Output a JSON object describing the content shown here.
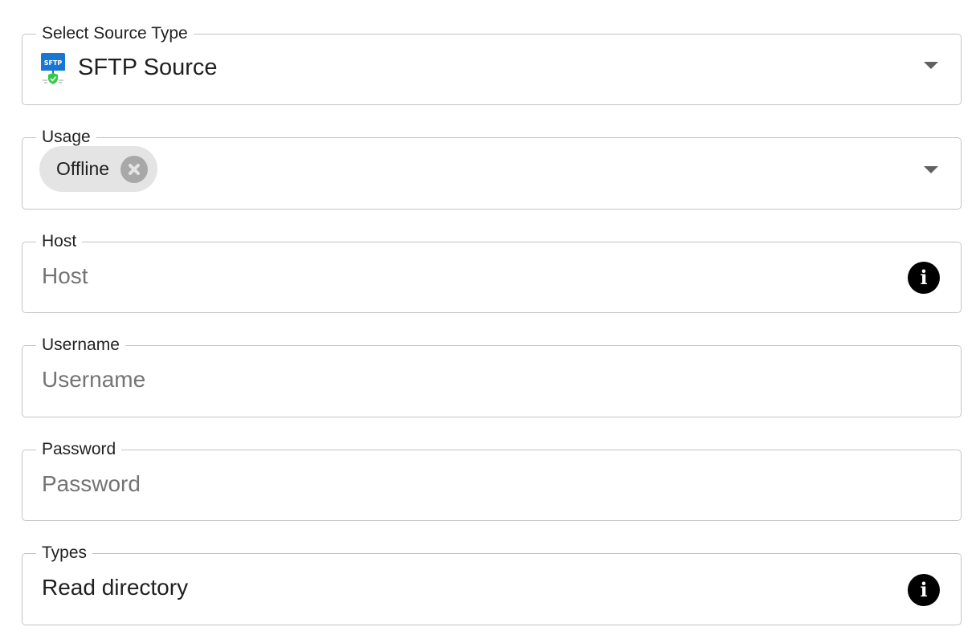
{
  "form": {
    "source_type": {
      "label": "Select Source Type",
      "value": "SFTP Source",
      "icon": "sftp-icon",
      "icon_text": "SFTP",
      "dropdown_icon": "chevron-down-icon"
    },
    "usage": {
      "label": "Usage",
      "chips": [
        {
          "label": "Offline",
          "remove_icon": "close-circle-icon"
        }
      ],
      "dropdown_icon": "chevron-down-icon"
    },
    "host": {
      "label": "Host",
      "placeholder": "Host",
      "value": "",
      "help_icon": "info-icon"
    },
    "username": {
      "label": "Username",
      "placeholder": "Username",
      "value": ""
    },
    "password": {
      "label": "Password",
      "placeholder": "Password",
      "value": ""
    },
    "types": {
      "label": "Types",
      "value": "Read directory",
      "help_icon": "info-icon",
      "dropdown_icon": "chevron-down-icon"
    }
  },
  "colors": {
    "border": "#c4c4c4",
    "chip_background": "#e4e4e4",
    "sftp_icon_blue": "#1976d2",
    "sftp_shield_green": "#2ecc40",
    "placeholder_text": "#747474"
  }
}
